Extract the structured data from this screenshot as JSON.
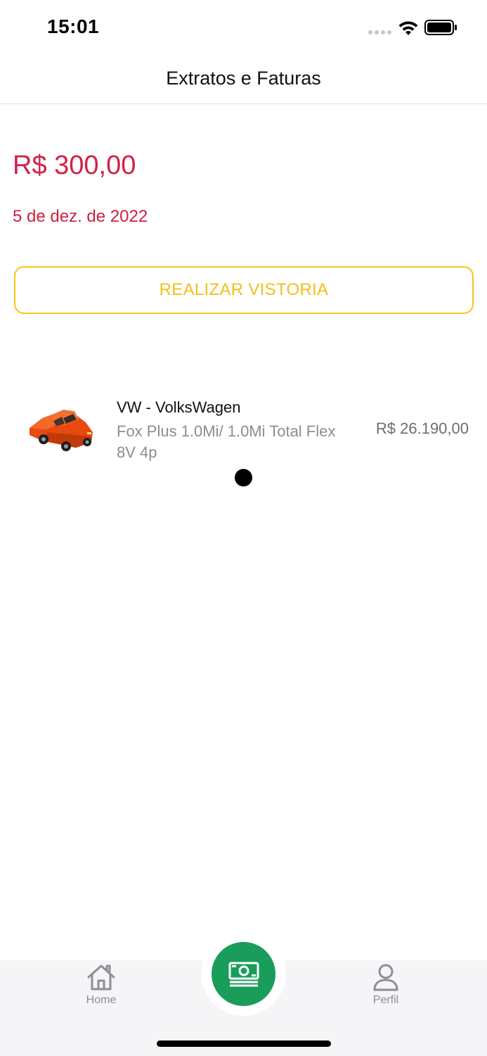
{
  "status_bar": {
    "time": "15:01",
    "icons": [
      "cellular-signal-icon",
      "wifi-icon",
      "battery-icon"
    ]
  },
  "header": {
    "title": "Extratos e Faturas"
  },
  "summary": {
    "amount": "R$ 300,00",
    "date": "5 de dez. de 2022"
  },
  "actions": {
    "vistoria_label": "REALIZAR VISTORIA"
  },
  "vehicle": {
    "image": "red-car-icon",
    "brand": "VW - VolksWagen",
    "model": "Fox Plus 1.0Mi/ 1.0Mi Total Flex 8V 4p",
    "price": "R$ 26.190,00"
  },
  "tab_bar": {
    "items": [
      {
        "label": "Home",
        "icon": "home-icon"
      },
      {
        "label": "",
        "icon": "money-icon"
      },
      {
        "label": "Perfil",
        "icon": "person-icon"
      }
    ]
  },
  "colors": {
    "amount": "#d32048",
    "accent_yellow": "#f5c518",
    "fab_green": "#1a9c5b",
    "tab_inactive": "#8e8e93"
  }
}
